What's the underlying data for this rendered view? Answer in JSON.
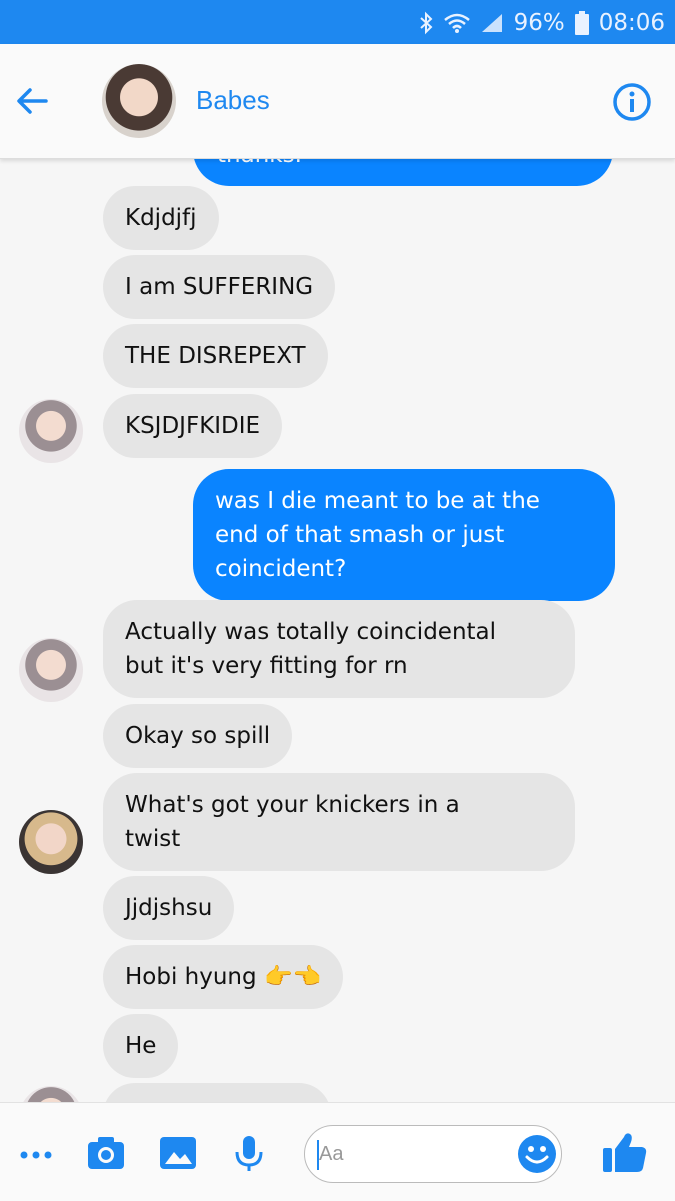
{
  "status": {
    "battery": "96%",
    "time": "08:06"
  },
  "header": {
    "contact_name": "Babes"
  },
  "messages": [
    {
      "dir": "out",
      "text": "thanks."
    },
    {
      "dir": "in",
      "text": "Kdjdjfj"
    },
    {
      "dir": "in",
      "text": "I am SUFFERING"
    },
    {
      "dir": "in",
      "text": "THE DISREPEXT"
    },
    {
      "dir": "in",
      "text": "KSJDJFKIDIE"
    },
    {
      "dir": "out",
      "lines": [
        "was I die meant to be at the",
        "end of that smash or just",
        "coincident?"
      ]
    },
    {
      "dir": "in",
      "lines": [
        "Actually was totally coincidental",
        "but it's very fitting for rn"
      ]
    },
    {
      "dir": "in",
      "text": "Okay so spill"
    },
    {
      "dir": "in",
      "lines": [
        "What's got your knickers in a",
        "twist"
      ]
    },
    {
      "dir": "in",
      "text": "Jjdjshsu"
    },
    {
      "dir": "in",
      "text": "Hobi hyung",
      "emoji": "👉👈"
    },
    {
      "dir": "in",
      "text": "He"
    }
  ],
  "composer": {
    "placeholder": "Aa"
  },
  "colors": {
    "accent": "#1e88f0",
    "outgoing_bubble": "#0a84ff",
    "incoming_bubble": "#e5e5e5"
  }
}
